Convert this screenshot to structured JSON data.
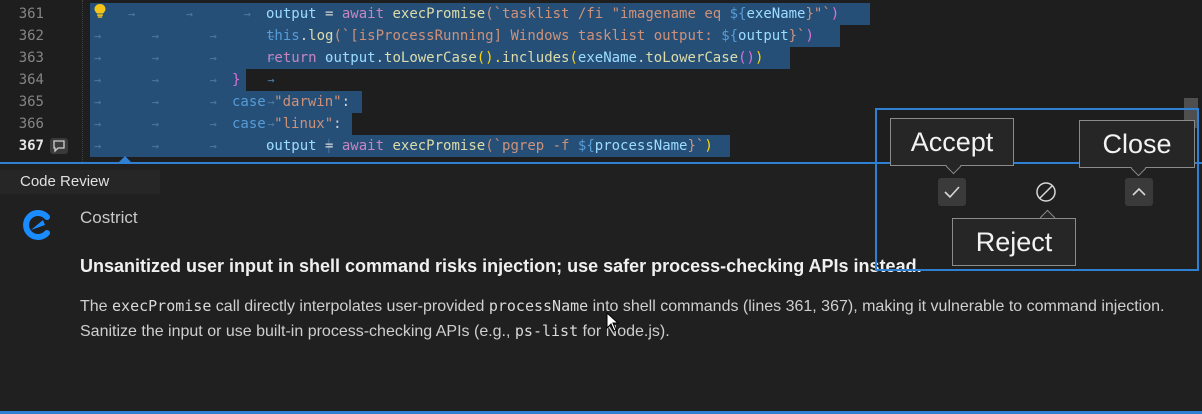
{
  "editor": {
    "lines": [
      {
        "number": "361"
      },
      {
        "number": "362"
      },
      {
        "number": "363"
      },
      {
        "number": "364"
      },
      {
        "number": "365"
      },
      {
        "number": "366"
      },
      {
        "number": "367"
      }
    ],
    "code": {
      "l361": [
        "output",
        " = ",
        "await",
        " ",
        "execPromise",
        "(`tasklist /fi \"imagename eq ",
        "${",
        "exeName",
        "}\"`",
        ")"
      ],
      "l362": [
        "this",
        ".",
        "log",
        "(`[isProcessRunning] Windows tasklist output: ",
        "${",
        "output",
        "}`",
        ")"
      ],
      "l363": [
        "return",
        " ",
        "output",
        ".",
        "toLowerCase",
        "().",
        "includes",
        "(",
        "exeName",
        ".",
        "toLowerCase",
        "()",
        ")"
      ],
      "l364": [
        "}"
      ],
      "l365": [
        "case",
        " ",
        "\"darwin\"",
        ":"
      ],
      "l366": [
        "case",
        " ",
        "\"linux\"",
        ":"
      ],
      "l367": [
        "output",
        " = ",
        "await",
        " ",
        "execPromise",
        "(`pgrep -f ",
        "${",
        "processName",
        "}`",
        ")"
      ]
    }
  },
  "panel": {
    "title": "Code Review",
    "author": "Costrict",
    "headline": "Unsanitized user input in shell command risks injection; use safer process-checking APIs instead.",
    "body": {
      "p1": "The ",
      "c1": "execPromise",
      "p2": " call directly interpolates user-provided ",
      "c2": "processName",
      "p3": " into shell commands (lines 361, 367), making it vulnerable to command injection. Sanitize the input or use built-in process-checking APIs (e.g., ",
      "c3": "ps-list",
      "p4": " for Node.js)."
    }
  },
  "actions": {
    "accept_tooltip": "Accept",
    "reject_tooltip": "Reject",
    "close_tooltip": "Close",
    "accept_icon": "check-icon",
    "reject_icon": "circle-slash-icon",
    "close_icon": "chevron-up-icon"
  },
  "colors": {
    "selection": "#264f78",
    "accent": "#2f7fd3",
    "keyword": "#c586c0",
    "string": "#ce9178"
  }
}
